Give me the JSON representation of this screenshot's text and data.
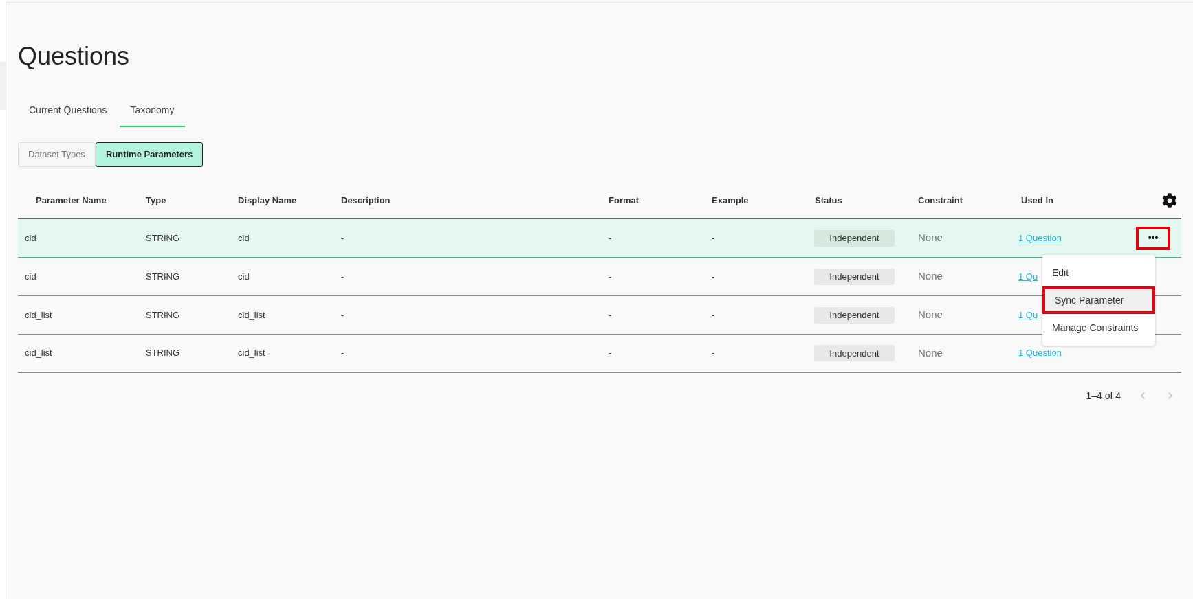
{
  "title": "Questions",
  "tabs": [
    {
      "label": "Current Questions",
      "selected": false
    },
    {
      "label": "Taxonomy",
      "selected": true
    }
  ],
  "segments": [
    {
      "label": "Dataset Types",
      "selected": false
    },
    {
      "label": "Runtime Parameters",
      "selected": true
    }
  ],
  "table": {
    "columns": [
      "Parameter Name",
      "Type",
      "Display Name",
      "Description",
      "Format",
      "Example",
      "Status",
      "Constraint",
      "Used In"
    ],
    "rows": [
      {
        "selected": true,
        "cells": [
          "cid",
          "STRING",
          "cid",
          "-",
          "-",
          "-"
        ],
        "status": "Independent",
        "constraint": "None",
        "used_in": "1 Question",
        "actions": {
          "label": "•••",
          "highlighted": true
        }
      },
      {
        "selected": false,
        "cells": [
          "cid",
          "STRING",
          "cid",
          "-",
          "-",
          "-"
        ],
        "status": "Independent",
        "constraint": "None",
        "used_in": "1 Qu"
      },
      {
        "selected": false,
        "cells": [
          "cid_list",
          "STRING",
          "cid_list",
          "-",
          "-",
          "-"
        ],
        "status": "Independent",
        "constraint": "None",
        "used_in": "1 Qu"
      },
      {
        "selected": false,
        "cells": [
          "cid_list",
          "STRING",
          "cid_list",
          "-",
          "-",
          "-"
        ],
        "status": "Independent",
        "constraint": "None",
        "used_in": "1 Question"
      }
    ]
  },
  "menu": {
    "items": [
      {
        "label": "Edit",
        "highlighted": false
      },
      {
        "label": "Sync Parameter",
        "highlighted": true
      },
      {
        "label": "Manage Constraints",
        "highlighted": false
      }
    ]
  },
  "pagination": {
    "range": "1–4 of 4",
    "prev_disabled": true,
    "next_disabled": true
  }
}
